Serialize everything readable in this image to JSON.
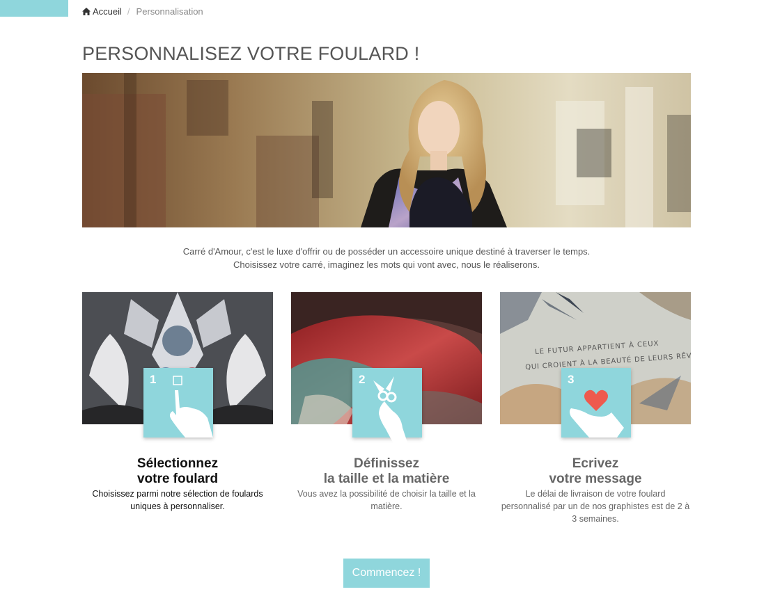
{
  "breadcrumb": {
    "home_label": "Accueil",
    "separator": "/",
    "current": "Personnalisation"
  },
  "page": {
    "title": "PERSONNALISEZ VOTRE FOULARD !"
  },
  "intro": {
    "line1": "Carré d'Amour, c'est le luxe d'offrir ou de posséder un accessoire unique destiné à traverser le temps.",
    "line2": "Choisissez votre carré, imaginez les mots qui vont avec, nous le réaliserons."
  },
  "steps": [
    {
      "number": "1",
      "title_line1": "Sélectionnez",
      "title_line2": "votre foulard",
      "description": "Choisissez parmi notre sélection de foulards uniques à personnaliser.",
      "icon": "hand-pointer-icon"
    },
    {
      "number": "2",
      "title_line1": "Définissez",
      "title_line2": "la taille et la matière",
      "description": "Vous avez la possibilité de choisir la taille et la matière.",
      "icon": "hand-scissors-icon"
    },
    {
      "number": "3",
      "title_line1": "Ecrivez",
      "title_line2": "votre message",
      "description": "Le délai de livraison de votre foulard personnalisé par un de nos graphistes est de 2 à 3 semaines.",
      "icon": "hand-heart-icon",
      "photo_text_line1": "LE FUTUR APPARTIENT À CEUX",
      "photo_text_line2": "QUI CROIENT À LA BEAUTÉ DE LEURS RÊVES."
    }
  ],
  "cta": {
    "label": "Commencez !"
  },
  "colors": {
    "accent": "#8fd6dc",
    "title": "#555555"
  },
  "icons": {
    "home": "home-icon"
  }
}
